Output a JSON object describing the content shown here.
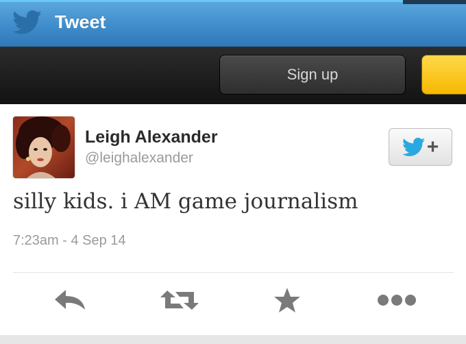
{
  "header": {
    "title": "Tweet",
    "bird_icon": "twitter-bird-icon",
    "bird_color": "#2b6fa8"
  },
  "toolbar": {
    "signup_label": "Sign up",
    "accent_color": "#f6b800"
  },
  "tweet": {
    "author_name": "Leigh Alexander",
    "author_handle": "@leighalexander",
    "text": "silly kids. i AM game journalism",
    "timestamp": "7:23am - 4 Sep 14",
    "follow_button": {
      "icon": "twitter-bird-follow-icon",
      "plus": "+",
      "color": "#2aa9e0"
    }
  },
  "actions": [
    {
      "icon": "reply-icon"
    },
    {
      "icon": "retweet-icon"
    },
    {
      "icon": "favorite-star-icon"
    },
    {
      "icon": "more-options-icon"
    }
  ]
}
